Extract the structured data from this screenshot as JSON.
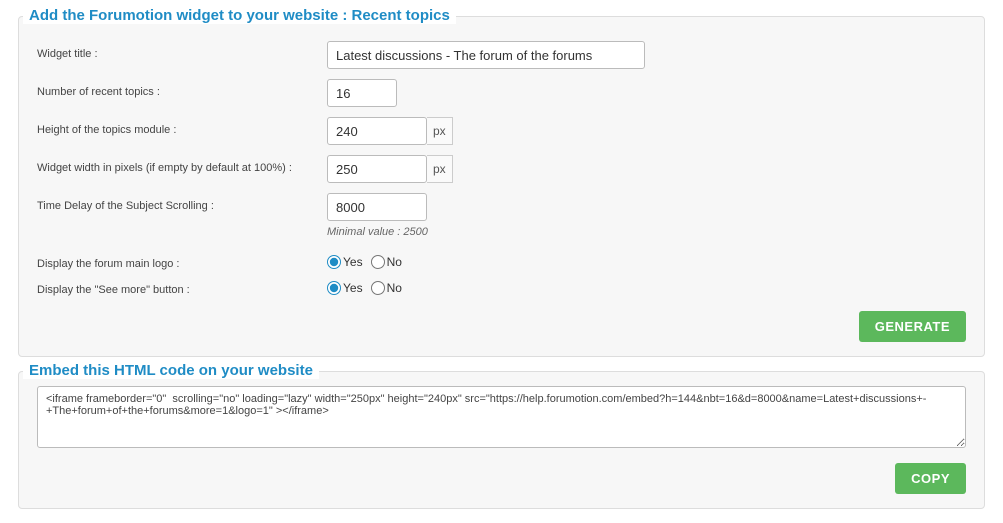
{
  "form": {
    "legend": "Add the Forumotion widget to your website : Recent topics",
    "fields": {
      "title_label": "Widget title :",
      "title_value": "Latest discussions - The forum of the forums",
      "num_label": "Number of recent topics :",
      "num_value": "16",
      "height_label": "Height of the topics module :",
      "height_value": "240",
      "height_unit": "px",
      "width_label": "Widget width in pixels (if empty by default at 100%) :",
      "width_value": "250",
      "width_unit": "px",
      "delay_label": "Time Delay of the Subject Scrolling :",
      "delay_value": "8000",
      "delay_hint": "Minimal value : 2500",
      "logo_label": "Display the forum main logo :",
      "seemore_label": "Display the \"See more\" button :",
      "yes": "Yes",
      "no": "No"
    },
    "generate_button": "GENERATE"
  },
  "embed": {
    "legend": "Embed this HTML code on your website",
    "code": "<iframe frameborder=\"0\"  scrolling=\"no\" loading=\"lazy\" width=\"250px\" height=\"240px\" src=\"https://help.forumotion.com/embed?h=144&nbt=16&d=8000&name=Latest+discussions+-+The+forum+of+the+forums&more=1&logo=1\" ></iframe>",
    "copy_button": "COPY"
  }
}
